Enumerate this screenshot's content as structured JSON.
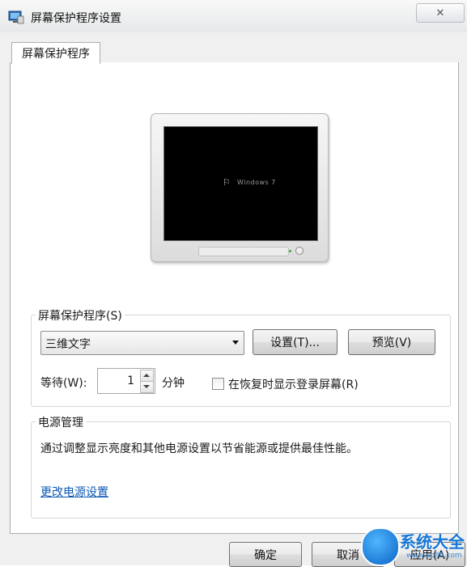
{
  "window": {
    "title": "屏幕保护程序设置",
    "close_glyph": "✕"
  },
  "tabs": [
    {
      "label": "屏幕保护程序",
      "selected": true
    }
  ],
  "preview": {
    "screen_text": "Windows 7"
  },
  "screensaver": {
    "group_label": "屏幕保护程序(S)",
    "selected": "三维文字",
    "settings_button": "设置(T)...",
    "preview_button": "预览(V)",
    "wait_label": "等待(W):",
    "wait_value": "1",
    "wait_unit": "分钟",
    "resume_checkbox_label": "在恢复时显示登录屏幕(R)",
    "resume_checked": false
  },
  "power": {
    "group_label": "电源管理",
    "description": "通过调整显示亮度和其他电源设置以节省能源或提供最佳性能。",
    "link": "更改电源设置"
  },
  "footer": {
    "ok_label": "确定",
    "cancel_label": "取消",
    "apply_label": "应用(A)"
  },
  "watermark": {
    "text": "系统大全",
    "sub": "www.xp85.com"
  },
  "colors": {
    "link": "#0b56b3",
    "watermark": "#1677d6",
    "background": "#f0f0f0"
  }
}
